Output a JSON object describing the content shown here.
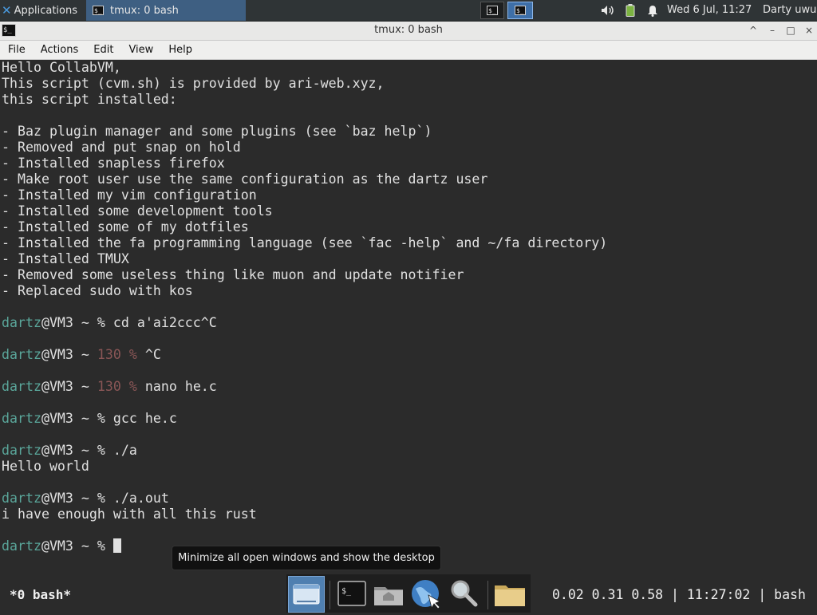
{
  "top_panel": {
    "applications_label": "Applications",
    "task_label": "tmux: 0 bash",
    "clock": "Wed  6 Jul, 11:27",
    "user": "Darty uwu",
    "tray_icons": [
      "volume-icon",
      "battery-icon",
      "notification-bell-icon"
    ]
  },
  "window": {
    "title": "tmux: 0 bash",
    "buttons": [
      "^",
      "–",
      "□",
      "×"
    ]
  },
  "menubar": [
    "File",
    "Actions",
    "Edit",
    "View",
    "Help"
  ],
  "terminal": {
    "lines": [
      "Hello CollabVM,",
      "This script (cvm.sh) is provided by ari-web.xyz,",
      "this script installed:",
      "",
      "- Baz plugin manager and some plugins (see `baz help`)",
      "- Removed and put snap on hold",
      "- Installed snapless firefox",
      "- Make root user use the same configuration as the dartz user",
      "- Installed my vim configuration",
      "- Installed some development tools",
      "- Installed some of my dotfiles",
      "- Installed the fa programming language (see `fac -help` and ~/fa directory)",
      "- Installed TMUX",
      "- Removed some useless thing like muon and update notifier",
      "- Replaced sudo with kos"
    ],
    "prompt_user": "dartz",
    "prompt_host": "@VM3 ~ ",
    "prompt_symbol": "%",
    "sessions": [
      {
        "code": "",
        "command": "cd a'ai2ccc^C",
        "output": []
      },
      {
        "code": "130",
        "command": "^C",
        "output": []
      },
      {
        "code": "130",
        "command": "nano he.c",
        "output": []
      },
      {
        "code": "",
        "command": "gcc he.c",
        "output": []
      },
      {
        "code": "",
        "command": "./a",
        "output": [
          "Hello world"
        ]
      },
      {
        "code": "",
        "command": "./a.out",
        "output": [
          "i have enough with all this rust"
        ]
      }
    ]
  },
  "tooltip": "Minimize all open windows and show the desktop",
  "tmux_status": {
    "window": "*0 bash*",
    "right": "0.02 0.31 0.58 | 11:27:02 | bash"
  },
  "dock": {
    "items": [
      "show-desktop-icon",
      "terminal-icon",
      "home-folder-icon",
      "web-browser-icon",
      "search-icon",
      "files-folder-icon"
    ]
  }
}
